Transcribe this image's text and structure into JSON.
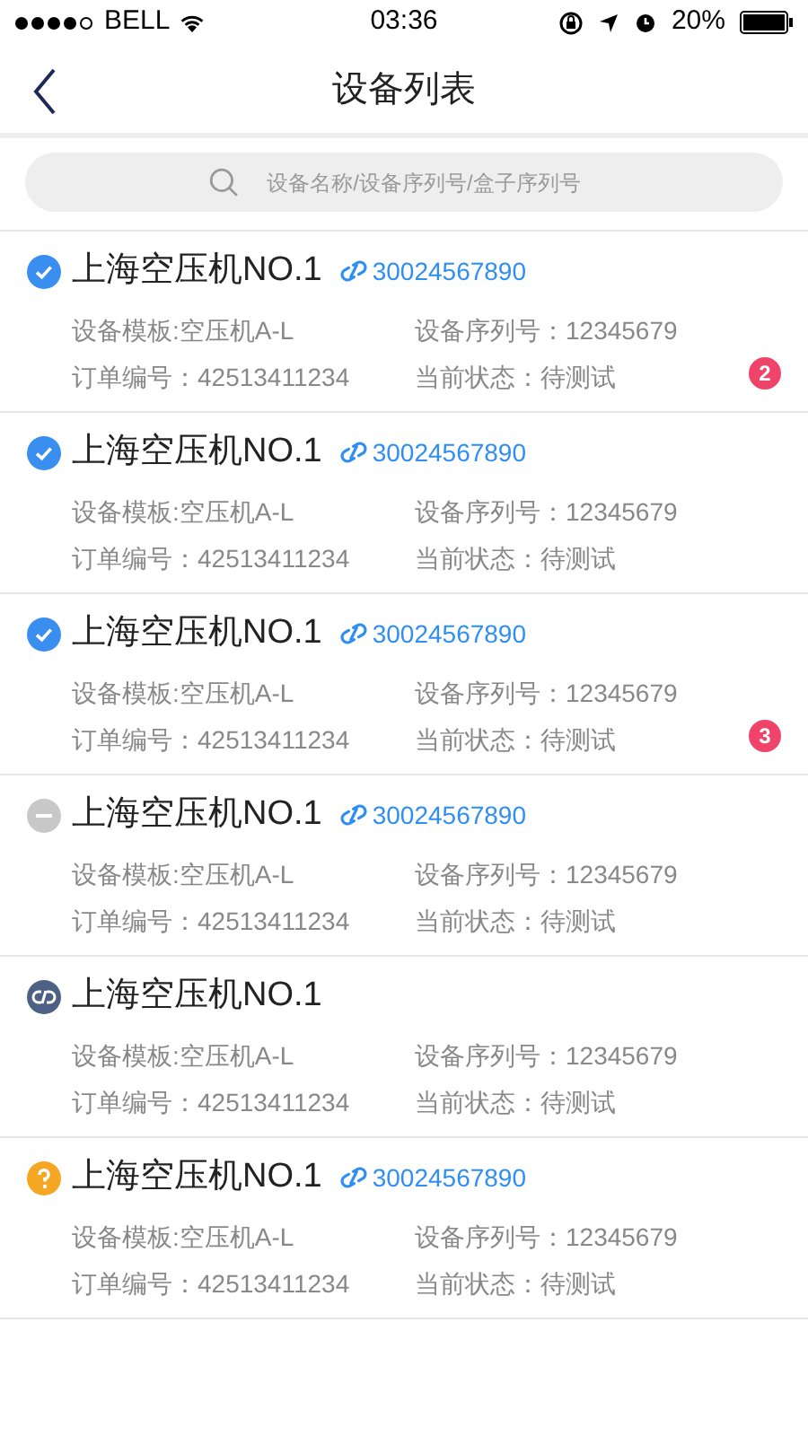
{
  "status_bar": {
    "carrier": "BELL",
    "time": "03:36",
    "battery": "20%"
  },
  "nav": {
    "title": "设备列表"
  },
  "search": {
    "placeholder": "设备名称/设备序列号/盒子序列号"
  },
  "devices": [
    {
      "kind": "done",
      "name": "上海空压机NO.1",
      "link": "30024567890",
      "template": "设备模板:空压机A-L",
      "serial": "设备序列号：12345679",
      "order": "订单编号：42513411234",
      "state": "当前状态：待测试",
      "badge": "2"
    },
    {
      "kind": "done",
      "name": "上海空压机NO.1",
      "link": "30024567890",
      "template": "设备模板:空压机A-L",
      "serial": "设备序列号：12345679",
      "order": "订单编号：42513411234",
      "state": "当前状态：待测试"
    },
    {
      "kind": "done",
      "name": "上海空压机NO.1",
      "link": "30024567890",
      "template": "设备模板:空压机A-L",
      "serial": "设备序列号：12345679",
      "order": "订单编号：42513411234",
      "state": "当前状态：待测试",
      "badge": "3"
    },
    {
      "kind": "inactive",
      "name": "上海空压机NO.1",
      "link": "30024567890",
      "template": "设备模板:空压机A-L",
      "serial": "设备序列号：12345679",
      "order": "订单编号：42513411234",
      "state": "当前状态：待测试"
    },
    {
      "kind": "unlinked",
      "name": "上海空压机NO.1",
      "template": "设备模板:空压机A-L",
      "serial": "设备序列号：12345679",
      "order": "订单编号：42513411234",
      "state": "当前状态：待测试"
    },
    {
      "kind": "unknown",
      "name": "上海空压机NO.1",
      "link": "30024567890",
      "template": "设备模板:空压机A-L",
      "serial": "设备序列号：12345679",
      "order": "订单编号：42513411234",
      "state": "当前状态：待测试"
    }
  ]
}
